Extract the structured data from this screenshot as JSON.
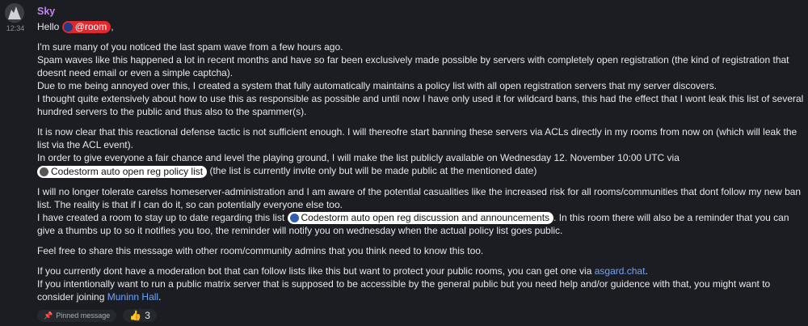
{
  "message": {
    "time": "12:34",
    "sender": "Sky",
    "greeting": "Hello",
    "mention": "@room",
    "greeting_comma": ",",
    "para1": [
      "I'm sure many of you noticed the last spam wave from a few hours ago.",
      "Spam waves like this happened a lot in recent months and have so far been exclusively made possible by servers with completely open registration (the kind of registration that doesnt need email or even a simple captcha).",
      "Due to me being annoyed over this, I created a system that fully automatically maintains a policy list with all open registration servers that my server discovers.",
      "I thought quite extensively about how to use this as responsible as possible and until now I have only used it for wildcard bans, this had the effect that I wont leak this list of several hundred servers to the public and thus also to the spammer(s)."
    ],
    "para2_line1": "It is now clear that this reactional defense tactic is not sufficient enough. I will thereofre start banning these servers via ACLs directly in my rooms from now on (which will leak the list via the ACL event).",
    "para2_line2_pre": "In order to give everyone a fair chance and level the playing ground, I will make the list publicly available on Wednesday 12. November 10:00 UTC via",
    "policy_pill": "Codestorm auto open reg policy list",
    "para2_line2_post": "(the list is currently invite only but will be made public at the mentioned date)",
    "para3_line1": "I will no longer tolerate carelss homeserver-administration and I am aware of the potential casualities like the increased risk for all rooms/communities that dont follow my new ban list. The reality is that if I can do it, so can potentially everyone else too.",
    "para3_line2_pre": "I have created a room to stay up to date regarding this list",
    "discussion_pill": "Codestorm auto open reg discussion and announcements",
    "para3_line2_post": ". In this room there will also be a reminder that you can give a thumbs up to so it notifies you too, the reminder will notify you on wednesday when the actual policy list goes public.",
    "para4": "Feel free to share this message with other room/community admins that you think need to know this too.",
    "para5_line1_pre": "If you currently dont have a moderation bot that can follow lists like this but want to protect your public rooms, you can get one via",
    "link_asgard": "asgard.chat",
    "para5_line1_post": ".",
    "para5_line2_pre": "If you intentionally want to run a public matrix server that is supposed to be accessible by the general public but you need help and/or guidence with that, you might want to consider joining",
    "link_muninn": "Muninn Hall",
    "para5_line2_post": "."
  },
  "footer": {
    "pinned_label": "Pinned message",
    "reaction_emoji": "👍",
    "reaction_count": "3"
  },
  "colors": {
    "background": "#1b1d22",
    "sender": "#c483f2",
    "mention": "#e0282e",
    "link": "#6ea3ff"
  }
}
